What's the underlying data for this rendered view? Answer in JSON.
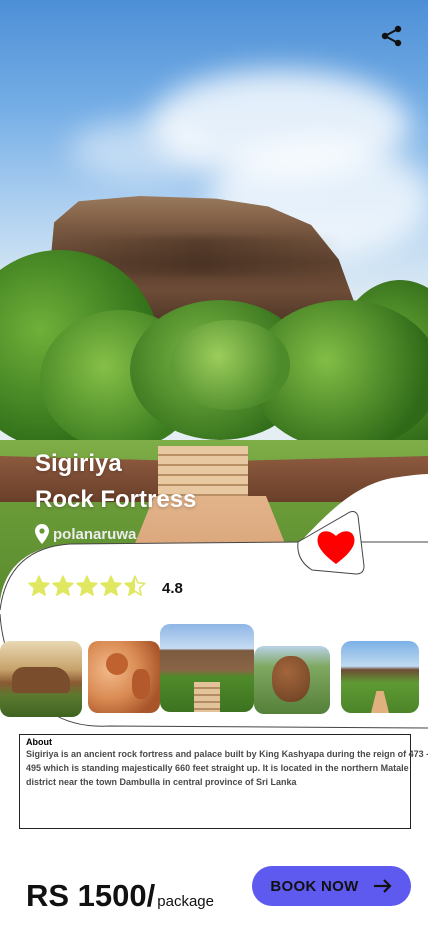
{
  "place": {
    "title_line1": "Sigiriya",
    "title_line2": "Rock Fortress",
    "location": "polanaruwa"
  },
  "rating": {
    "value": 4.8,
    "value_label": "4.8",
    "stars_max": 5,
    "star_color": "#dfe860"
  },
  "gallery": {
    "photos": [
      {
        "name": "rock-sunset"
      },
      {
        "name": "fresco-painting"
      },
      {
        "name": "rock-steps-view"
      },
      {
        "name": "aerial-rock-view"
      },
      {
        "name": "garden-path-view"
      }
    ]
  },
  "about": {
    "heading": "About",
    "text": "Sigiriya is an ancient rock fortress and palace built by King Kashyapa during the reign of 473 - 495 which is standing majestically 660 feet straight up. It is located in the northern Matale district near the town Dambulla in central province of Sri Lanka"
  },
  "booking": {
    "price": "RS 1500/",
    "price_unit": "package",
    "button_label": "BOOK NOW"
  },
  "icons": {
    "share": "share-icon",
    "location": "location-pin-icon",
    "favorite": "heart-icon",
    "arrow": "arrow-right-icon"
  },
  "colors": {
    "accent_button": "#5e5af0",
    "heart": "#ff0000",
    "title_text": "#ffffff"
  }
}
